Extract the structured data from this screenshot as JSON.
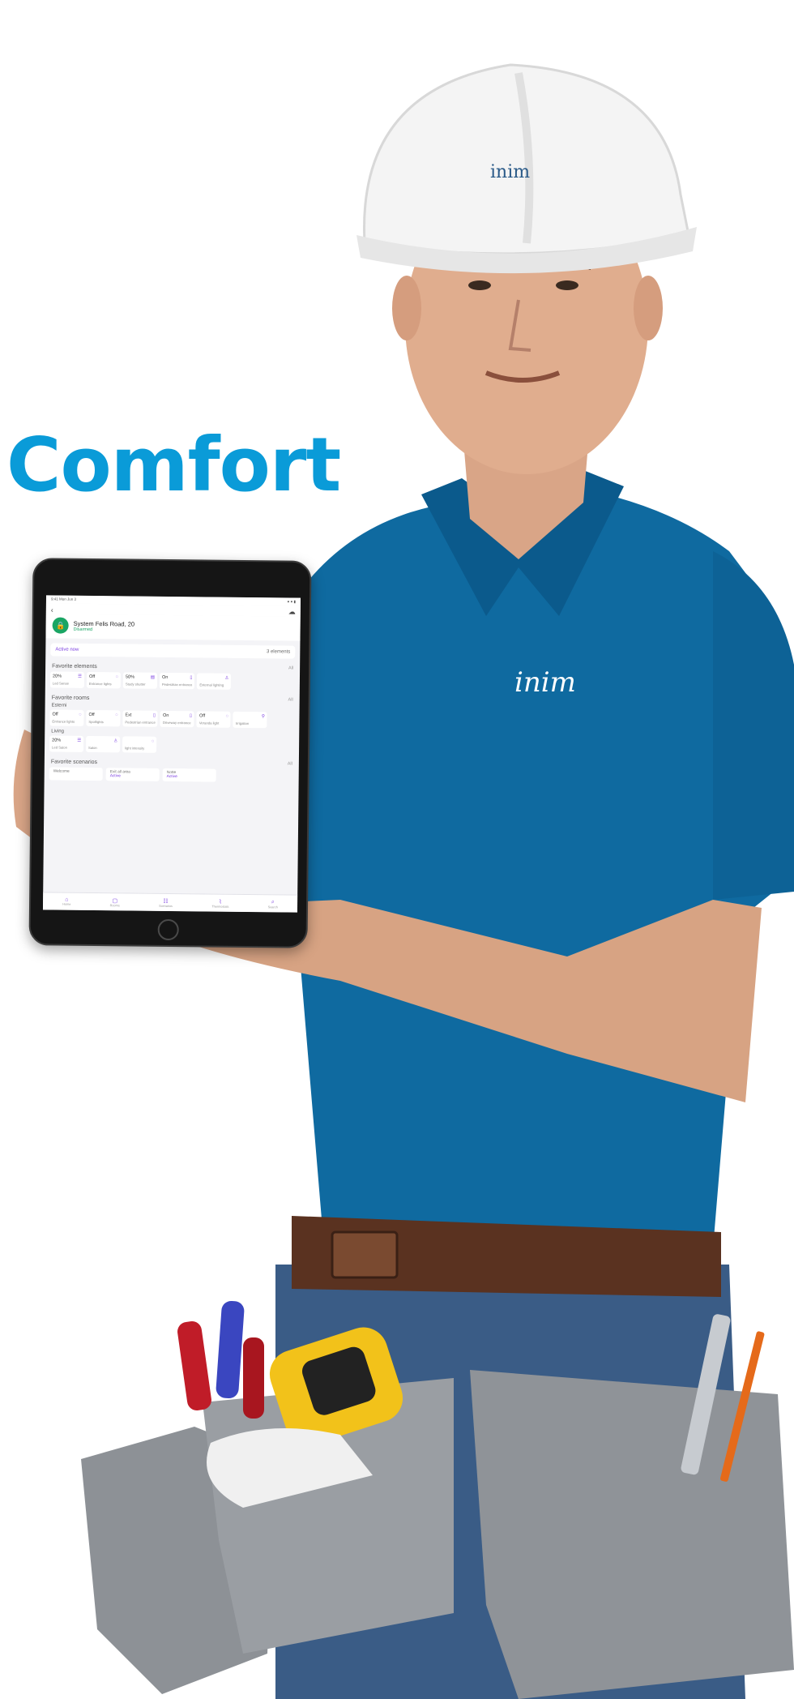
{
  "headline": {
    "text": "Comfort",
    "color": "#0a9bd8"
  },
  "brand": {
    "helmet_logo": "inim",
    "shirt_logo": "inim"
  },
  "app": {
    "system_name": "System Felis Road, 20",
    "system_state": "Disarmed",
    "active_now": "Active now",
    "active_count": "3 elements",
    "favorite_elements": {
      "title": "Favorite elements",
      "all": "All",
      "cards": [
        {
          "value": "20%",
          "icon": "blinds-icon",
          "label": "Led Sense"
        },
        {
          "value": "Off",
          "icon": "light-icon",
          "label": "Entrance lights"
        },
        {
          "value": "50%",
          "icon": "shutter-icon",
          "label": "Study shutter"
        },
        {
          "value": "On",
          "icon": "door-icon",
          "label": "Pedestrian entrance"
        },
        {
          "value": "",
          "icon": "person-icon",
          "label": "External lighting"
        }
      ]
    },
    "favorite_rooms": {
      "title": "Favorite rooms",
      "all": "All",
      "rooms": [
        {
          "name": "Esterni",
          "cards": [
            {
              "value": "Off",
              "icon": "light-icon",
              "label": "Entrance lights"
            },
            {
              "value": "Off",
              "icon": "light-icon",
              "label": "Spotlights"
            },
            {
              "value": "Ext",
              "icon": "door-icon",
              "label": "Pedestrian entrance"
            },
            {
              "value": "On",
              "icon": "door-icon",
              "label": "Driveway entrance"
            },
            {
              "value": "Off",
              "icon": "light-icon",
              "label": "Veranda light"
            },
            {
              "value": "",
              "icon": "sprinkler-icon",
              "label": "Irrigation"
            }
          ]
        },
        {
          "name": "Living",
          "cards": [
            {
              "value": "20%",
              "icon": "blinds-icon",
              "label": "Led Salon"
            },
            {
              "value": "",
              "icon": "person-icon",
              "label": "Salon"
            },
            {
              "value": "",
              "icon": "light-icon",
              "label": "light intensity"
            }
          ]
        }
      ]
    },
    "favorite_scenarios": {
      "title": "Favorite scenarios",
      "all": "All",
      "items": [
        {
          "name": "Welcome",
          "state": ""
        },
        {
          "name": "Exit all area",
          "state": "Active"
        },
        {
          "name": "Notte",
          "state": "Active"
        }
      ]
    },
    "nav": [
      "Home",
      "Rooms",
      "Scenarios",
      "Thermostats",
      "Search"
    ]
  }
}
